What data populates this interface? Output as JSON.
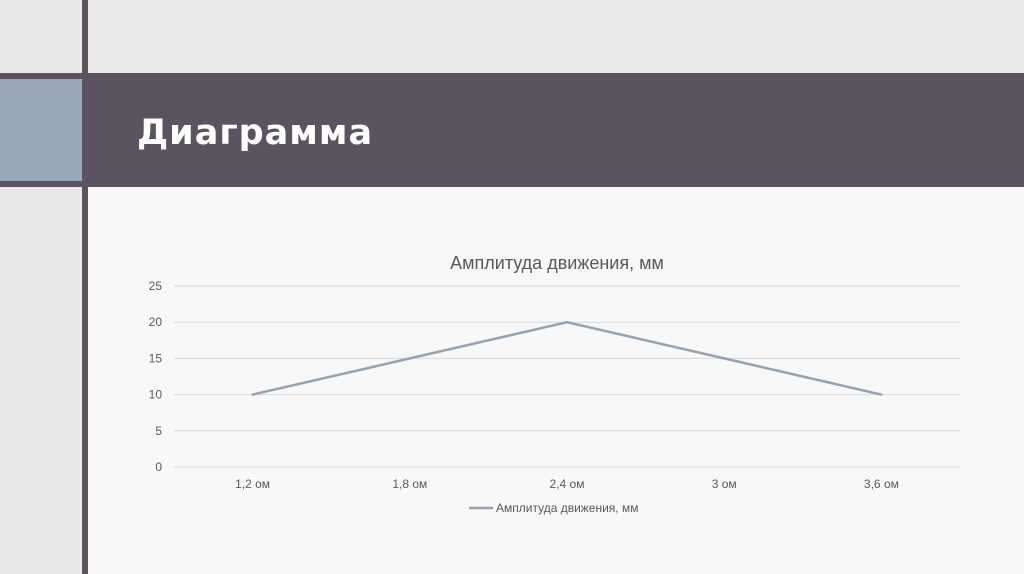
{
  "slide": {
    "title": "Диаграмма"
  },
  "colors": {
    "title_bar": "#5b5460",
    "accent": "#9aa9b8",
    "series_line": "#97a3ae",
    "gridline": "#d9d9d9",
    "text": "#595959"
  },
  "chart_data": {
    "type": "line",
    "title": "Амплитуда движения, мм",
    "categories": [
      "1,2 ом",
      "1,8 ом",
      "2,4 ом",
      "3 ом",
      "3,6 ом"
    ],
    "series": [
      {
        "name": "Амплитуда движения, мм",
        "values": [
          10,
          15,
          20,
          15,
          10
        ]
      }
    ],
    "ylim": [
      0,
      25
    ],
    "yticks": [
      "0",
      "5",
      "10",
      "15",
      "20",
      "25"
    ],
    "grid": true,
    "legend": "bottom"
  }
}
